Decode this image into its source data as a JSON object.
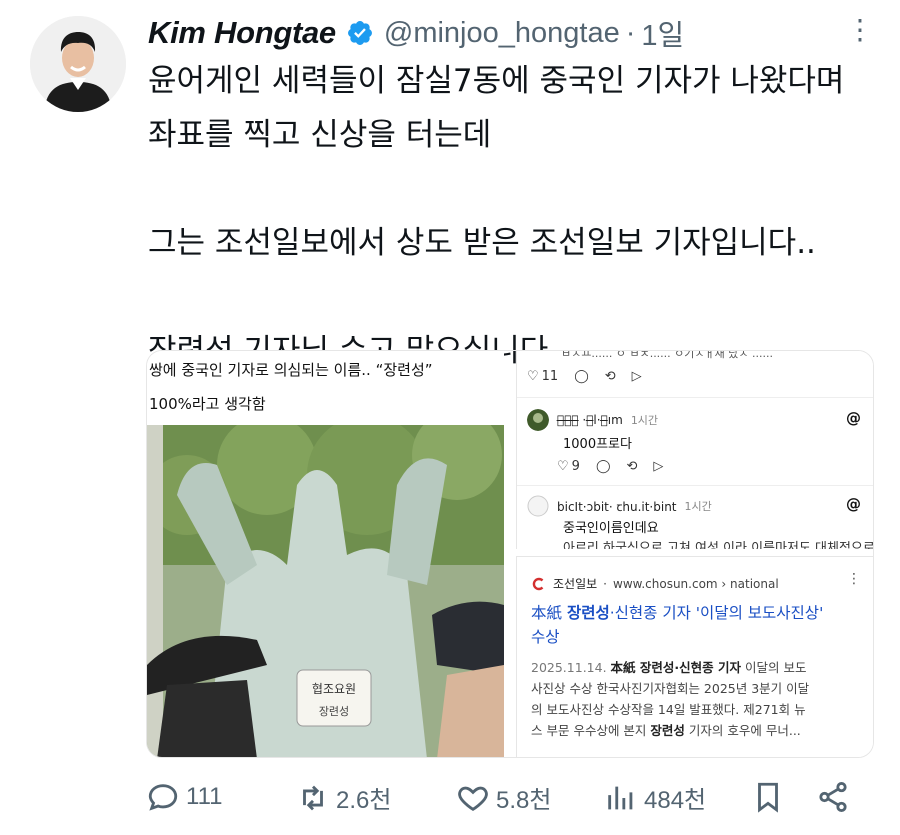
{
  "author": {
    "name": "Kim Hongtae",
    "handle": "@minjoo_hongtae",
    "separator": "·",
    "time": "1일",
    "verified_icon": "verified-badge-icon",
    "more_icon": "more-dots-icon"
  },
  "tweet": {
    "lines": [
      "윤어게인 세력들이 잠실7동에 중국인 기자가 나왔다며",
      "좌표를 찍고 신상을 터는데",
      "",
      "그는 조선일보에서 상도 받은 조선일보 기자입니다..",
      "",
      "장련성 기자님 수고 많으십니다.."
    ]
  },
  "media": {
    "left_photo": {
      "caption1": "쌍에 중국인 기자로 의심되는 이름.. “장련성”",
      "caption2": "100%라고 생각함",
      "badge_text": "협조요원",
      "badge_name": "장련성"
    },
    "threads": {
      "top_fragment": "ㅂㅈㅛ...... ㅇ ㅂㅊ...... ㅇ기ㅈㅐ재 났ㅈ ......",
      "row1_likes": "11",
      "comment1": {
        "user": "ㅅ̶ㄴ̶ㅂ̶ ·ㅂ̶l·ㅂ̶ım",
        "time": "1시간",
        "text": "1000프로다",
        "likes": "9"
      },
      "comment2": {
        "user": "bicIt·ɔbit· ꞇhu.it·bint",
        "time": "1시간",
        "text1": "중국인이름인데요",
        "text2": "아르리 하국식으로 고쳐 여성 이라 이름마저도 대체적으로"
      },
      "threads_icon": "threads-logo-icon"
    },
    "search_result": {
      "source": "조선일보",
      "url": "www.chosun.com › national",
      "title_a": "本紙 ",
      "title_name": "장련성",
      "title_b": "·신현종 기자 '이달의 보도사진상'",
      "title_c": "수상",
      "date": "2025.11.14.",
      "body_a": "本紙 ",
      "body_name1": "장련성",
      "body_b": "·신현종 ",
      "body_bold": "기자",
      "body_c": " 이달의 보도",
      "body_line2": "사진상 수상 한국사진기자협회는 2025년 3분기 이달",
      "body_line3": "의 보도사진상 수상작을 14일 발표했다. 제271회 뉴",
      "body_line4a": "스 부문 우수상에 본지 ",
      "body_name2": "장련성",
      "body_line4b": " 기자의 호우에 무너..."
    }
  },
  "actions": {
    "replies": "111",
    "retweets": "2.6천",
    "likes": "5.8천",
    "views": "484천",
    "icons": [
      "reply-icon",
      "retweet-icon",
      "like-icon",
      "views-icon",
      "bookmark-icon",
      "share-icon"
    ]
  },
  "colors": {
    "text": "#0f1419",
    "muted": "#536471",
    "verified": "#1d9bf0",
    "link": "#1a4fc4",
    "chosun_red": "#d32f2f"
  }
}
